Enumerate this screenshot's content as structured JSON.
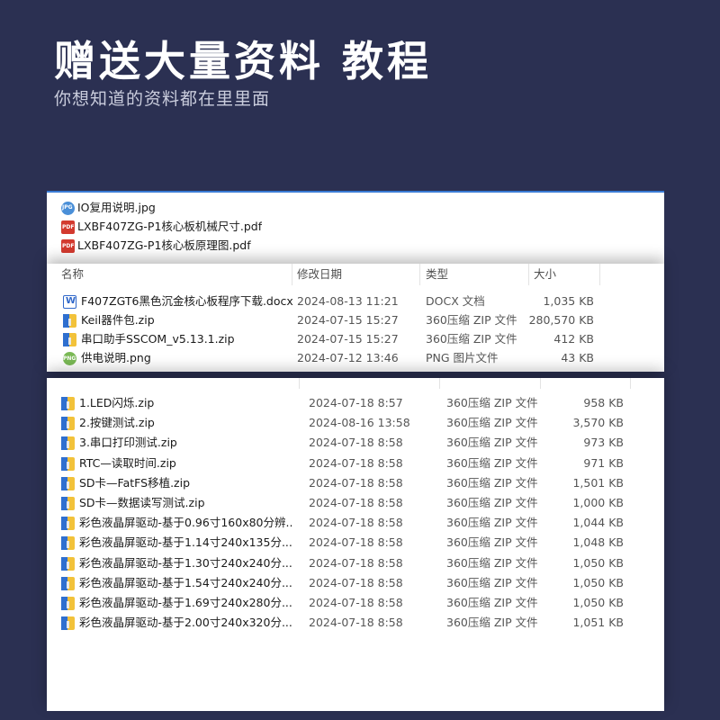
{
  "banner": {
    "title": "赠送大量资料 教程",
    "subtitle": "你想知道的资料都在里里面"
  },
  "panel1": {
    "files": [
      {
        "name": "IO复用说明.jpg",
        "icon": "jpg-file-icon"
      },
      {
        "name": "LXBF407ZG-P1核心板机械尺寸.pdf",
        "icon": "pdf-file-icon"
      },
      {
        "name": "LXBF407ZG-P1核心板原理图.pdf",
        "icon": "pdf-file-icon"
      }
    ]
  },
  "panel2": {
    "headers": {
      "name": "名称",
      "date": "修改日期",
      "type": "类型",
      "size": "大小"
    },
    "files": [
      {
        "name": "F407ZGT6黑色沉金核心板程序下载.docx",
        "date": "2024-08-13 11:21",
        "type": "DOCX 文档",
        "size": "1,035 KB",
        "icon": "docx"
      },
      {
        "name": "Keil器件包.zip",
        "date": "2024-07-15 15:27",
        "type": "360压缩 ZIP 文件",
        "size": "280,570 KB",
        "icon": "zip"
      },
      {
        "name": "串口助手SSCOM_v5.13.1.zip",
        "date": "2024-07-15 15:27",
        "type": "360压缩 ZIP 文件",
        "size": "412 KB",
        "icon": "zip"
      },
      {
        "name": "供电说明.png",
        "date": "2024-07-12 13:46",
        "type": "PNG 图片文件",
        "size": "43 KB",
        "icon": "png"
      }
    ]
  },
  "panel3": {
    "files": [
      {
        "name": "1.LED闪烁.zip",
        "date": "2024-07-18 8:57",
        "type": "360压缩 ZIP 文件",
        "size": "958 KB"
      },
      {
        "name": "2.按键测试.zip",
        "date": "2024-08-16 13:58",
        "type": "360压缩 ZIP 文件",
        "size": "3,570 KB"
      },
      {
        "name": "3.串口打印测试.zip",
        "date": "2024-07-18 8:58",
        "type": "360压缩 ZIP 文件",
        "size": "973 KB"
      },
      {
        "name": "RTC—读取时间.zip",
        "date": "2024-07-18 8:58",
        "type": "360压缩 ZIP 文件",
        "size": "971 KB"
      },
      {
        "name": "SD卡—FatFS移植.zip",
        "date": "2024-07-18 8:58",
        "type": "360压缩 ZIP 文件",
        "size": "1,501 KB"
      },
      {
        "name": "SD卡—数据读写测试.zip",
        "date": "2024-07-18 8:58",
        "type": "360压缩 ZIP 文件",
        "size": "1,000 KB"
      },
      {
        "name": "彩色液晶屏驱动-基于0.96寸160x80分辨...",
        "date": "2024-07-18 8:58",
        "type": "360压缩 ZIP 文件",
        "size": "1,044 KB"
      },
      {
        "name": "彩色液晶屏驱动-基于1.14寸240x135分...",
        "date": "2024-07-18 8:58",
        "type": "360压缩 ZIP 文件",
        "size": "1,048 KB"
      },
      {
        "name": "彩色液晶屏驱动-基于1.30寸240x240分...",
        "date": "2024-07-18 8:58",
        "type": "360压缩 ZIP 文件",
        "size": "1,050 KB"
      },
      {
        "name": "彩色液晶屏驱动-基于1.54寸240x240分...",
        "date": "2024-07-18 8:58",
        "type": "360压缩 ZIP 文件",
        "size": "1,050 KB"
      },
      {
        "name": "彩色液晶屏驱动-基于1.69寸240x280分...",
        "date": "2024-07-18 8:58",
        "type": "360压缩 ZIP 文件",
        "size": "1,050 KB"
      },
      {
        "name": "彩色液晶屏驱动-基于2.00寸240x320分...",
        "date": "2024-07-18 8:58",
        "type": "360压缩 ZIP 文件",
        "size": "1,051 KB"
      }
    ]
  }
}
